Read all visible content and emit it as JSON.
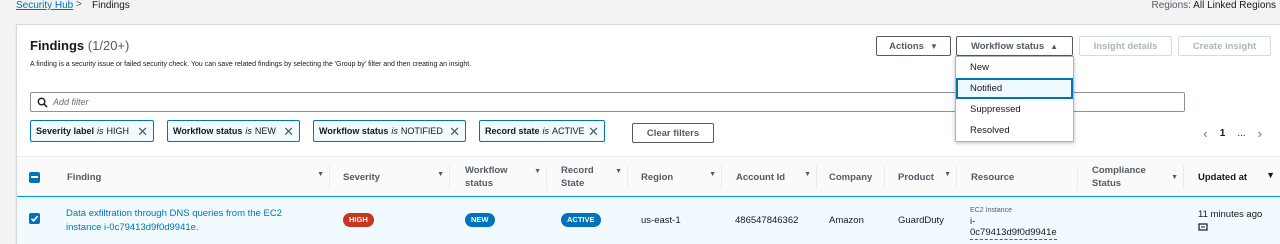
{
  "breadcrumb": {
    "root": "Security Hub",
    "separator": ">",
    "current": "Findings"
  },
  "regions": {
    "label": "Regions:",
    "value": "All Linked Regions"
  },
  "header": {
    "title": "Findings",
    "count": "(1/20+)",
    "description": "A finding is a security issue or failed security check. You can save related findings by selecting the 'Group by' filter and then creating an insight."
  },
  "toolbar": {
    "actions": "Actions",
    "workflow_status": "Workflow status",
    "insight_details": "Insight details",
    "create_insight": "Create insight"
  },
  "workflow_menu": [
    "New",
    "Notified",
    "Suppressed",
    "Resolved"
  ],
  "search": {
    "placeholder": "Add filter"
  },
  "filters": [
    {
      "key": "Severity label",
      "op": "is",
      "value": "HIGH"
    },
    {
      "key": "Workflow status",
      "op": "is",
      "value": "NEW"
    },
    {
      "key": "Workflow status",
      "op": "is",
      "value": "NOTIFIED"
    },
    {
      "key": "Record state",
      "op": "is",
      "value": "ACTIVE"
    }
  ],
  "clear_filters": "Clear filters",
  "pagination": {
    "prev": "‹",
    "page": "1",
    "ellipsis": "...",
    "next": "›"
  },
  "columns": {
    "finding": "Finding",
    "severity": "Severity",
    "workflow_1": "Workflow",
    "workflow_2": "status",
    "record_1": "Record",
    "record_2": "State",
    "region": "Region",
    "account": "Account Id",
    "company": "Company",
    "product": "Product",
    "resource": "Resource",
    "compliance_1": "Compliance",
    "compliance_2": "Status",
    "updated": "Updated at"
  },
  "row": {
    "finding_1": "Data exfiltration through DNS queries from the EC2",
    "finding_2": "instance i-0c79413d9f0d9941e.",
    "severity": "HIGH",
    "workflow": "NEW",
    "record": "ACTIVE",
    "region": "us-east-1",
    "account": "486547846362",
    "company": "Amazon",
    "product": "GuardDuty",
    "resource_type": "EC2 Instance",
    "resource_id_1": "i-",
    "resource_id_2": "0c79413d9f0d9941e",
    "updated": "11 minutes ago"
  },
  "colors": {
    "link": "#0073bb",
    "severity_high": "#c7371f",
    "selected_row": "#f1faff"
  }
}
